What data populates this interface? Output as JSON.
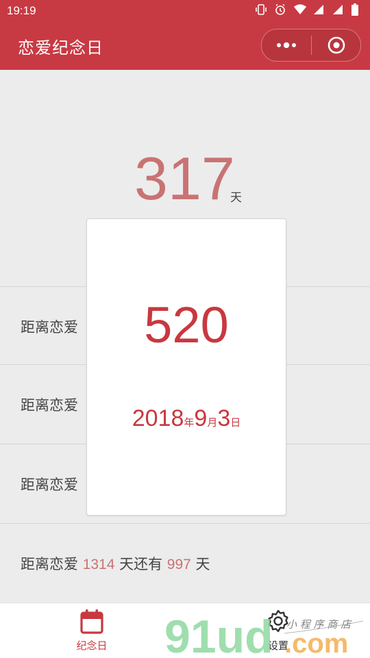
{
  "status_bar": {
    "time": "19:19"
  },
  "nav": {
    "title": "恋爱纪念日"
  },
  "hero": {
    "days": "317",
    "unit": "天"
  },
  "rows": [
    {
      "prefix": "距离恋爱"
    },
    {
      "prefix": "距离恋爱"
    },
    {
      "prefix": "距离恋爱"
    },
    {
      "prefix": "距离恋爱",
      "value": "1314",
      "middle": "天还有",
      "remaining": "997",
      "suffix": "天"
    }
  ],
  "popup": {
    "number": "520",
    "year": "2018",
    "year_unit": "年",
    "month": "9",
    "month_unit": "月",
    "day": "3",
    "day_unit": "日"
  },
  "tabs": [
    {
      "label": "纪念日",
      "icon": "calendar-icon",
      "active": true
    },
    {
      "label": "设置",
      "icon": "gear-icon",
      "active": false
    }
  ],
  "watermark": {
    "brand": "9lud.com",
    "tagline": "小程序商店"
  },
  "colors": {
    "primary": "#c83a43",
    "accent": "#c97373",
    "card_text": "#c8383f"
  }
}
